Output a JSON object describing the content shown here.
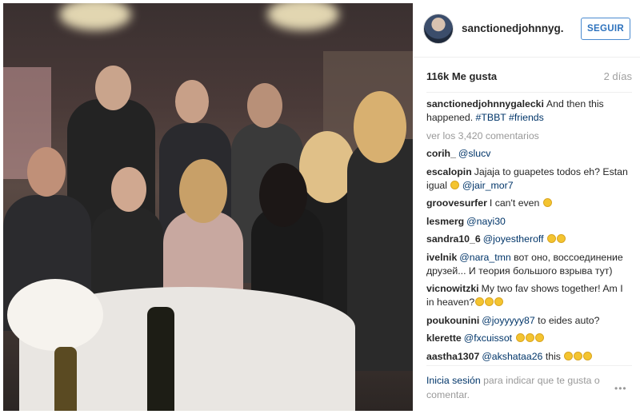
{
  "post": {
    "username": "sanctionedjohnnyg...",
    "follow_label": "SEGUIR",
    "likes": "116k Me gusta",
    "time_ago": "2 días",
    "view_comments": "ver los 3,420 comentarios",
    "photo_alt": "Group photo at a banquet table"
  },
  "comments": [
    {
      "user": "sanctionedjohnnygalecki",
      "parts": [
        {
          "type": "t",
          "text": "And then this happened."
        },
        {
          "type": "m",
          "text": " #TBBT #friends"
        }
      ]
    },
    {
      "user": "corih_",
      "parts": [
        {
          "type": "m",
          "text": "@slucv"
        }
      ]
    },
    {
      "user": "escalopin",
      "parts": [
        {
          "type": "t",
          "text": "Jajaja to guapetes todos eh? Estan igual "
        },
        {
          "type": "e"
        },
        {
          "type": "m",
          "text": " @jair_mor7"
        }
      ]
    },
    {
      "user": "groovesurfer",
      "parts": [
        {
          "type": "t",
          "text": "I can't even "
        },
        {
          "type": "e"
        }
      ]
    },
    {
      "user": "lesmerg",
      "parts": [
        {
          "type": "m",
          "text": "@nayi30"
        }
      ]
    },
    {
      "user": "sandra10_6",
      "parts": [
        {
          "type": "m",
          "text": "@joyestheroff "
        },
        {
          "type": "e"
        },
        {
          "type": "e"
        }
      ]
    },
    {
      "user": "ivelnik",
      "parts": [
        {
          "type": "m",
          "text": "@nara_tmn"
        },
        {
          "type": "t",
          "text": " вот оно, воссоединение друзей... И теория большого взрыва тут)"
        }
      ]
    },
    {
      "user": "vicnowitzki",
      "parts": [
        {
          "type": "t",
          "text": "My two fav shows together! Am I in heaven?"
        },
        {
          "type": "e"
        },
        {
          "type": "e"
        },
        {
          "type": "e"
        }
      ]
    },
    {
      "user": "poukounini",
      "parts": [
        {
          "type": "m",
          "text": "@joyyyyy87"
        },
        {
          "type": "t",
          "text": " to eides auto?"
        }
      ]
    },
    {
      "user": "klerette",
      "parts": [
        {
          "type": "m",
          "text": "@fxcuissot "
        },
        {
          "type": "e"
        },
        {
          "type": "e"
        },
        {
          "type": "e"
        }
      ]
    },
    {
      "user": "aastha1307",
      "parts": [
        {
          "type": "m",
          "text": "@akshataa26"
        },
        {
          "type": "t",
          "text": " this "
        },
        {
          "type": "e"
        },
        {
          "type": "e"
        },
        {
          "type": "e"
        }
      ]
    }
  ],
  "footer": {
    "login_link": "Inicia sesión",
    "rest": " para indicar que te gusta o comentar.",
    "more_icon": "ellipsis-icon"
  },
  "colors": {
    "accent": "#2d72bd",
    "mention": "#003569",
    "muted": "#999999"
  }
}
